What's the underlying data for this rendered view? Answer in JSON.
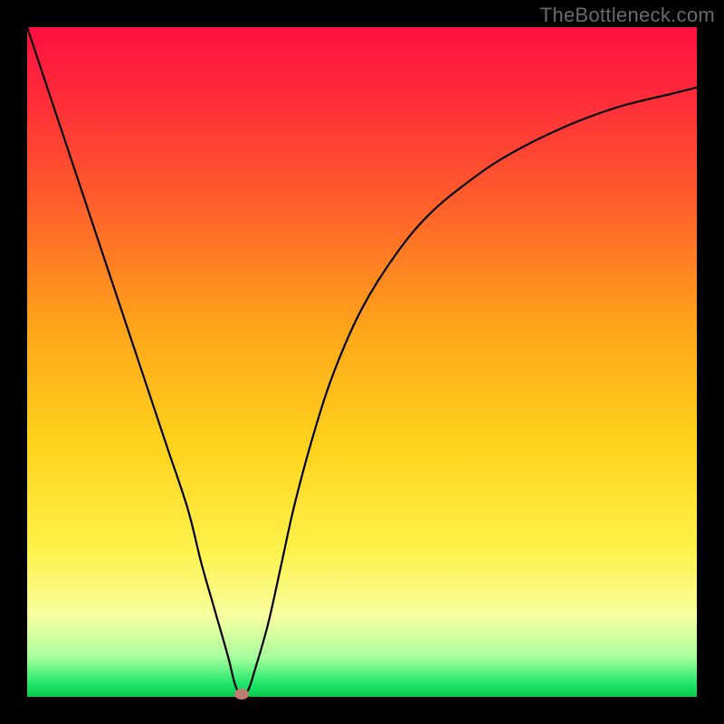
{
  "watermark": "TheBottleneck.com",
  "chart_data": {
    "type": "line",
    "title": "",
    "xlabel": "",
    "ylabel": "",
    "xlim": [
      0,
      100
    ],
    "ylim": [
      0,
      100
    ],
    "gradient_stops": [
      {
        "pct": 0,
        "color": "#ff1040"
      },
      {
        "pct": 10,
        "color": "#ff2a3a"
      },
      {
        "pct": 25,
        "color": "#ff5a2c"
      },
      {
        "pct": 45,
        "color": "#ffa51a"
      },
      {
        "pct": 62,
        "color": "#ffd21c"
      },
      {
        "pct": 78,
        "color": "#fff24a"
      },
      {
        "pct": 88,
        "color": "#f7ffa0"
      },
      {
        "pct": 94,
        "color": "#a9ff9e"
      },
      {
        "pct": 98,
        "color": "#20e86a"
      },
      {
        "pct": 100,
        "color": "#08c74a"
      }
    ],
    "series": [
      {
        "name": "bottleneck-curve",
        "x": [
          0,
          3,
          6,
          9,
          12,
          15,
          18,
          21,
          24,
          26,
          28,
          30,
          31,
          32,
          33,
          34,
          36,
          38,
          40,
          43,
          46,
          50,
          55,
          60,
          66,
          72,
          80,
          88,
          96,
          100
        ],
        "y": [
          100,
          91,
          82,
          73,
          64,
          55,
          46,
          37,
          28,
          20,
          13,
          6,
          2,
          0,
          1,
          4,
          11,
          20,
          29,
          40,
          49,
          58,
          66,
          72,
          77,
          81,
          85,
          88,
          90,
          91
        ]
      }
    ],
    "minimum_marker": {
      "x": 32,
      "y": 0,
      "color": "#c07a6f"
    }
  }
}
